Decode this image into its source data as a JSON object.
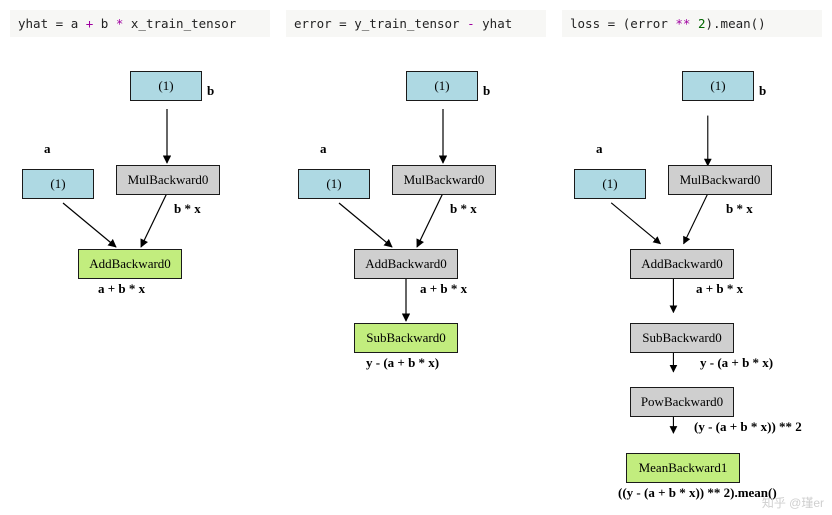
{
  "panels": [
    {
      "code_tokens": [
        {
          "t": "yhat",
          "c": "var"
        },
        {
          "t": " = ",
          "c": "kw"
        },
        {
          "t": "a",
          "c": "var"
        },
        {
          "t": " + ",
          "c": "op"
        },
        {
          "t": "b",
          "c": "var"
        },
        {
          "t": " * ",
          "c": "op"
        },
        {
          "t": "x_train_tensor",
          "c": "var"
        }
      ],
      "b_label": "b",
      "b_node": "(1)",
      "a_label": "a",
      "a_node": "(1)",
      "mul_node": "MulBackward0",
      "mul_label": "b * x",
      "add_node": "AddBackward0",
      "add_label": "a + b * x"
    },
    {
      "code_tokens": [
        {
          "t": "error",
          "c": "var"
        },
        {
          "t": " = ",
          "c": "kw"
        },
        {
          "t": "y_train_tensor",
          "c": "var"
        },
        {
          "t": " - ",
          "c": "op"
        },
        {
          "t": "yhat",
          "c": "var"
        }
      ],
      "b_label": "b",
      "b_node": "(1)",
      "a_label": "a",
      "a_node": "(1)",
      "mul_node": "MulBackward0",
      "mul_label": "b * x",
      "add_node": "AddBackward0",
      "add_label": "a + b * x",
      "sub_node": "SubBackward0",
      "sub_label": "y - (a + b * x)"
    },
    {
      "code_tokens": [
        {
          "t": "loss",
          "c": "var"
        },
        {
          "t": " = ",
          "c": "kw"
        },
        {
          "t": "(error ",
          "c": "var"
        },
        {
          "t": "**",
          "c": "op"
        },
        {
          "t": " ",
          "c": "kw"
        },
        {
          "t": "2",
          "c": "num"
        },
        {
          "t": ").mean()",
          "c": "var"
        }
      ],
      "b_label": "b",
      "b_node": "(1)",
      "a_label": "a",
      "a_node": "(1)",
      "mul_node": "MulBackward0",
      "mul_label": "b * x",
      "add_node": "AddBackward0",
      "add_label": "a + b * x",
      "sub_node": "SubBackward0",
      "sub_label": "y - (a + b * x)",
      "pow_node": "PowBackward0",
      "pow_label": "(y - (a + b * x)) ** 2",
      "mean_node": "MeanBackward1",
      "mean_label": "((y - (a + b * x)) ** 2).mean()"
    }
  ],
  "watermark": "知乎 @瑾er"
}
